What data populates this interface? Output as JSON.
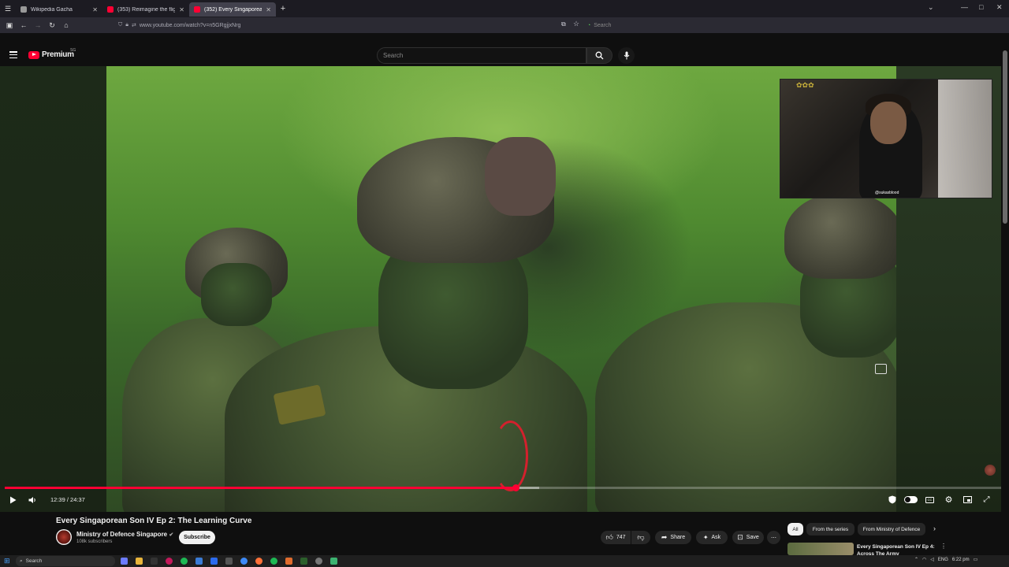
{
  "browser": {
    "tabs": [
      {
        "label": "Wikipedia Gacha",
        "active": false,
        "color": "#888888"
      },
      {
        "label": "(353) Reimagine the flight :",
        "active": false,
        "color": "#ff0033"
      },
      {
        "label": "(352) Every Singaporean So",
        "active": true,
        "color": "#ff0033"
      }
    ],
    "url": "www.youtube.com/watch?v=n5GRgjjxNrg",
    "search_placeholder": "Search"
  },
  "youtube": {
    "logo_word": "Premium",
    "logo_region": "SG",
    "search_placeholder": "Search",
    "overlay_tag": "@sukasblood"
  },
  "player": {
    "progress": 0.5111,
    "buffered": 0.535,
    "current_time": "12:39",
    "separator": " / ",
    "duration": "24:37"
  },
  "video": {
    "title": "Every Singaporean Son IV Ep 2: The Learning Curve",
    "channel": "Ministry of Defence Singapore",
    "subscribers": "108k subscribers",
    "subscribe_label": "Subscribe",
    "likes": "747",
    "share_label": "Share",
    "ask_label": "Ask",
    "save_label": "Save"
  },
  "recommendations": {
    "chips": [
      "All",
      "From the series",
      "From Ministry of Defence"
    ],
    "first_title": "Every Singaporean Son IV Ep 4: Across The Army"
  },
  "taskbar": {
    "search_placeholder": "Search",
    "lang": "ENG",
    "time": "6:22 pm"
  },
  "colors": {
    "accent": "#ff0033",
    "background": "#0f0f0f"
  }
}
